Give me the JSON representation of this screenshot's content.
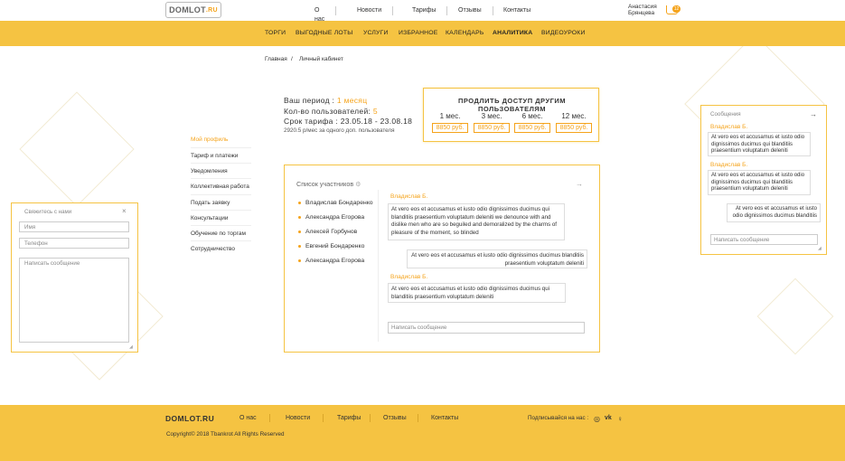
{
  "header": {
    "logo_text": "DOMLOT",
    "logo_suffix": ".RU",
    "nav": [
      "О нас",
      "Новости",
      "Тарифы",
      "Отзывы",
      "Контакты"
    ],
    "user_first": "Анастасия",
    "user_last": "Брянцева",
    "cart_count": "12"
  },
  "menu": [
    "ТОРГИ",
    "ВЫГОДНЫЕ ЛОТЫ",
    "УСЛУГИ",
    "ИЗБРАННОЕ",
    "КАЛЕНДАРЬ",
    "АНАЛИТИКА",
    "ВИДЕОУРОКИ"
  ],
  "breadcrumb": {
    "home": "Главная",
    "sep": "/",
    "current": "Личный кабинет"
  },
  "period": {
    "label1": "Ваш период :",
    "value1": "1 месяц",
    "label2": "Кол-во пользователей:",
    "value2": "5",
    "label3": "Срок тарифа :",
    "value3": "23.05.18 - 23.08.18",
    "note": "2920.5 р/мес за одного доп. пользователя"
  },
  "extend": {
    "title": "ПРОДЛИТЬ ДОСТУП ДРУГИМ ПОЛЬЗОВАТЕЛЯМ",
    "plans": [
      {
        "months": "1 мес.",
        "price": "8850 руб."
      },
      {
        "months": "3 мес.",
        "price": "8850 руб."
      },
      {
        "months": "6 мес.",
        "price": "8850 руб."
      },
      {
        "months": "12 мес.",
        "price": "8850 руб."
      }
    ]
  },
  "sidebar": [
    "Мой профиль",
    "Тариф и платежи",
    "Уведомления",
    "Коллективная работа",
    "Подать заявку",
    "Консультации",
    "Обучение по торгам",
    "Сотрудничество"
  ],
  "participants": {
    "label": "Список участников",
    "items": [
      "Владислав Бондаренко",
      "Александра Егорова",
      "Алексей Горбунов",
      "Евгений Бондаренко",
      "Александра Егорова"
    ]
  },
  "chat": {
    "name1": "Владислав Б.",
    "msg1": "At vero eos et accusamus et iusto odio dignissimos ducimus qui blanditiis praesentium voluptatum deleniti we denounce with and dislike men who are so beguiled and demoralized by the charms of pleasure of the moment, so blinded",
    "msg2": "At vero eos et accusamus et iusto odio dignissimos ducimus blanditiis praesentium voluptatum deleniti",
    "name3": "Владислав Б.",
    "msg3": "At vero eos et accusamus et iusto odio dignissimos ducimus qui blanditiis praesentium voluptatum deleniti",
    "input": "Написать сообщение"
  },
  "contact": {
    "title": "Свяжитесь с нами",
    "close": "×",
    "name": "Имя",
    "phone": "Телефон",
    "message": "Написать сообщение"
  },
  "messages_panel": {
    "title": "Сообщения",
    "name1": "Владислав Б.",
    "msg1": "At vero eos et accusamus et iusto odio dignissimos ducimus qui blanditiis praesentium voluptatum deleniti",
    "name2": "Владислав Б.",
    "msg2": "At vero eos et accusamus et iusto odio dignissimos ducimus qui blanditiis praesentium voluptatum deleniti",
    "msg3": "At vero eos et accusamus et iusto odio dignissimos ducimus blanditiis",
    "input": "Написать сообщение"
  },
  "footer": {
    "logo": "DOMLOT.RU",
    "nav": [
      "О нас",
      "Новости",
      "Тарифы",
      "Отзывы",
      "Контакты"
    ],
    "copyright": "Copyright© 2018 Tbankrot All Rights Reserved",
    "subscribe": "Подписывайся на нас :"
  },
  "colors": {
    "accent": "#f5c342",
    "accent_text": "#f5a31a"
  }
}
